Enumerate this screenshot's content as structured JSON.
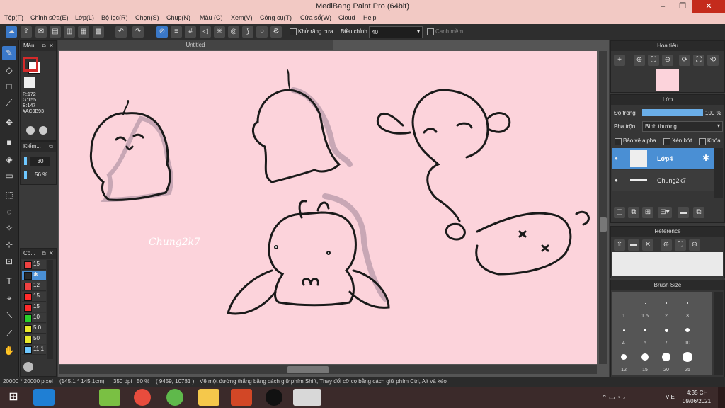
{
  "window": {
    "title": "MediBang Paint Pro (64bit)",
    "minimize": "–",
    "restore": "❐",
    "close": "✕"
  },
  "menu": [
    "Tệp(F)",
    "Chỉnh sửa(E)",
    "Lớp(L)",
    "Bộ lọc(R)",
    "Chọn(S)",
    "Chụp(N)",
    "Màu (C)",
    "Xem(V)",
    "Công cụ(T)",
    "Cửa sổ(W)",
    "Cloud",
    "Help"
  ],
  "toolbar": {
    "antialias_label": "Khử răng cưa",
    "adjust_label": "Điều chỉnh",
    "adjust_value": "40",
    "edge_label": "Canh mềm"
  },
  "color_panel": {
    "title": "Màu",
    "r": "R:172",
    "g": "G:155",
    "b": "B:147",
    "hex": "#AC9B93",
    "fg_color": "#ac9b93"
  },
  "brush_panel": {
    "title": "Kiểm...",
    "size_value": "30",
    "opacity_value": "56 %"
  },
  "color_list": {
    "title": "Co...",
    "items": [
      {
        "color": "#ef4141",
        "value": "15"
      },
      {
        "color": "#2a2a2a",
        "value": "✱"
      },
      {
        "color": "#ef4141",
        "value": "12"
      },
      {
        "color": "#ff2b2b",
        "value": "15"
      },
      {
        "color": "#ff2b2b",
        "value": "15"
      },
      {
        "color": "#2ad12a",
        "value": "10"
      },
      {
        "color": "#e8e82a",
        "value": "5.0"
      },
      {
        "color": "#e8e82a",
        "value": "50"
      },
      {
        "color": "#6ec8ff",
        "value": "11.1"
      }
    ]
  },
  "document": {
    "tab_title": "Untitled",
    "signature": "Chung2k7"
  },
  "navigator": {
    "title": "Hoa tiêu"
  },
  "layers": {
    "title": "Lớp",
    "opacity_label": "Độ trong",
    "opacity_value": "100 %",
    "opacity_fraction": 1.0,
    "blend_label": "Pha trộn",
    "blend_value": "Bình thường",
    "protect_alpha": "Bảo vệ alpha",
    "clipping": "Xén bớt",
    "lock": "Khóa",
    "items": [
      {
        "name": "Lớp4"
      },
      {
        "name": "Chung2k7"
      }
    ]
  },
  "reference": {
    "title": "Reference"
  },
  "brush_size": {
    "title": "Brush Size",
    "sizes": [
      "1",
      "1.5",
      "2",
      "3",
      "4",
      "5",
      "7",
      "10",
      "12",
      "15",
      "20",
      "25"
    ]
  },
  "status": {
    "dims": "20000 * 20000 pixel",
    "phys": "(145.1 * 145.1cm)",
    "dpi": "350 dpi",
    "zoom": "50 %",
    "coords": "( 9459, 10781 )",
    "hint": "Vẽ một đường thẳng bằng cách giữ phím Shift, Thay đổi cỡ cọ bằng cách giữ phím Ctrl, Alt và kéo"
  },
  "taskbar": {
    "lang": "VIE",
    "time": "4:35 CH",
    "date": "09/06/2021"
  }
}
